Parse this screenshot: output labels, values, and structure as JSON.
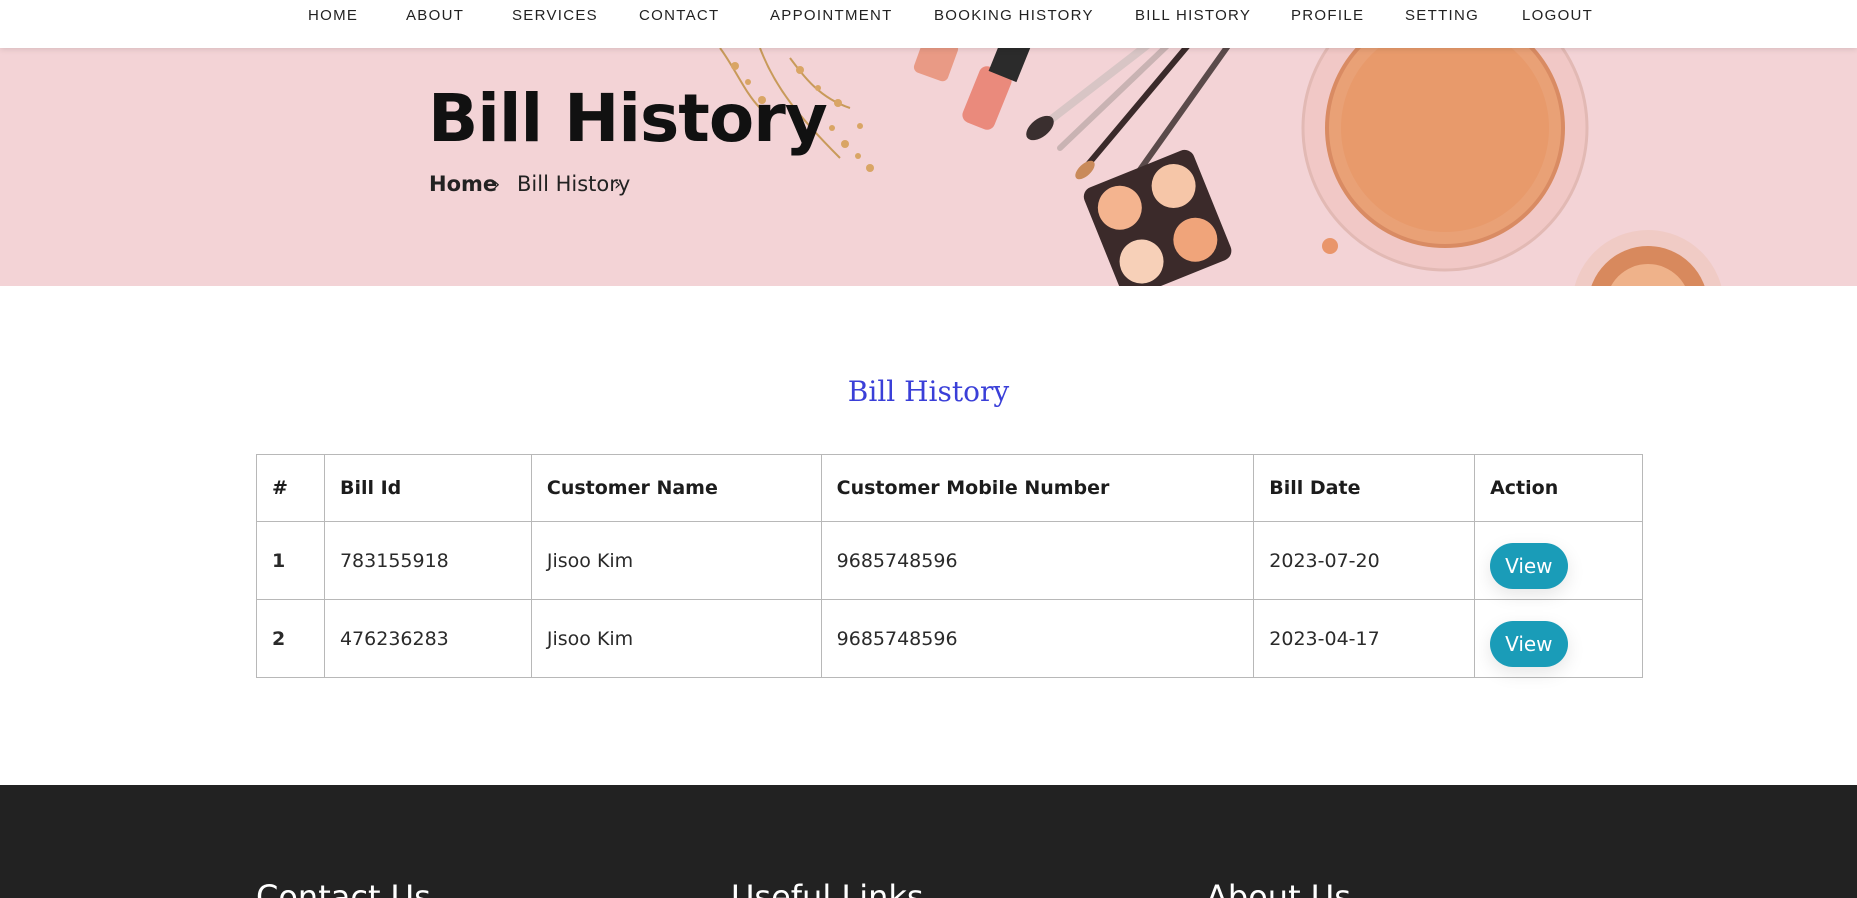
{
  "nav": {
    "items": [
      "HOME",
      "ABOUT",
      "SERVICES",
      "CONTACT",
      "APPOINTMENT",
      "BOOKING HISTORY",
      "BILL HISTORY",
      "PROFILE",
      "SETTING",
      "LOGOUT"
    ]
  },
  "hero": {
    "title": "Bill History",
    "breadcrumb": {
      "home": "Home",
      "current": "Bill History"
    }
  },
  "main": {
    "section_title": "Bill History",
    "table": {
      "headers": [
        "#",
        "Bill Id",
        "Customer Name",
        "Customer Mobile Number",
        "Bill Date",
        "Action"
      ],
      "rows": [
        {
          "index": "1",
          "bill_id": "783155918",
          "customer_name": "Jisoo Kim",
          "mobile": "9685748596",
          "bill_date": "2023-07-20",
          "action": "View"
        },
        {
          "index": "2",
          "bill_id": "476236283",
          "customer_name": "Jisoo Kim",
          "mobile": "9685748596",
          "bill_date": "2023-04-17",
          "action": "View"
        }
      ]
    }
  },
  "footer": {
    "headings": [
      "Contact Us",
      "Useful Links",
      "About Us"
    ]
  },
  "colors": {
    "hero_bg": "#f3d3d6",
    "section_title": "#3a3fd8",
    "button": "#1a9cb8",
    "footer_bg": "#222222"
  }
}
